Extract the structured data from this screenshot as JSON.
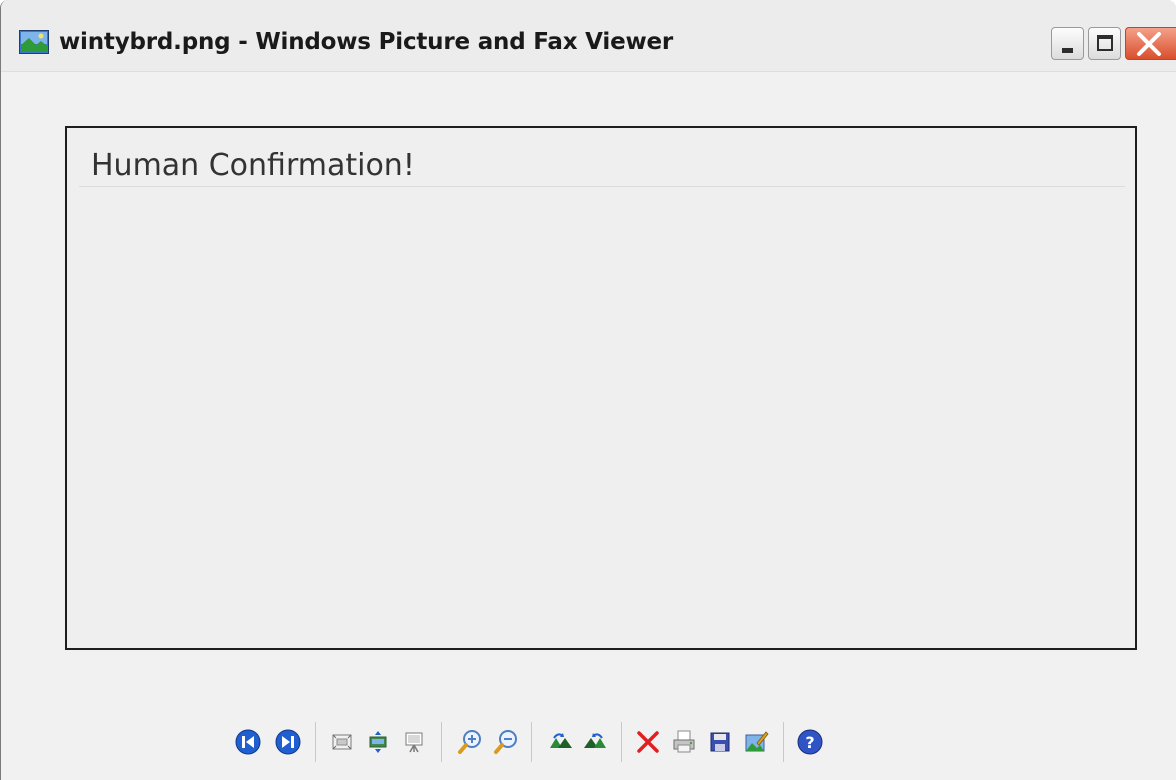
{
  "window": {
    "title": "wintybrd.png - Windows Picture and Fax Viewer"
  },
  "image": {
    "heading": "Human Confirmation!"
  },
  "toolbar": {
    "buttons": [
      {
        "name": "previous-image",
        "icon": "previous-icon"
      },
      {
        "name": "next-image",
        "icon": "next-icon"
      },
      {
        "name": "best-fit",
        "icon": "best-fit-icon"
      },
      {
        "name": "actual-size",
        "icon": "actual-size-icon"
      },
      {
        "name": "slide-show",
        "icon": "slideshow-icon"
      },
      {
        "name": "zoom-in",
        "icon": "zoom-in-icon"
      },
      {
        "name": "zoom-out",
        "icon": "zoom-out-icon"
      },
      {
        "name": "rotate-clockwise",
        "icon": "rotate-clockwise-icon"
      },
      {
        "name": "rotate-counterclockwise",
        "icon": "rotate-counterclockwise-icon"
      },
      {
        "name": "delete",
        "icon": "delete-icon"
      },
      {
        "name": "print",
        "icon": "print-icon"
      },
      {
        "name": "save",
        "icon": "save-icon"
      },
      {
        "name": "edit",
        "icon": "edit-icon"
      },
      {
        "name": "help",
        "icon": "help-icon"
      }
    ]
  },
  "colors": {
    "nav_blue": "#1f5fcf",
    "delete_red": "#e02020",
    "close_red": "#d94f2c"
  }
}
